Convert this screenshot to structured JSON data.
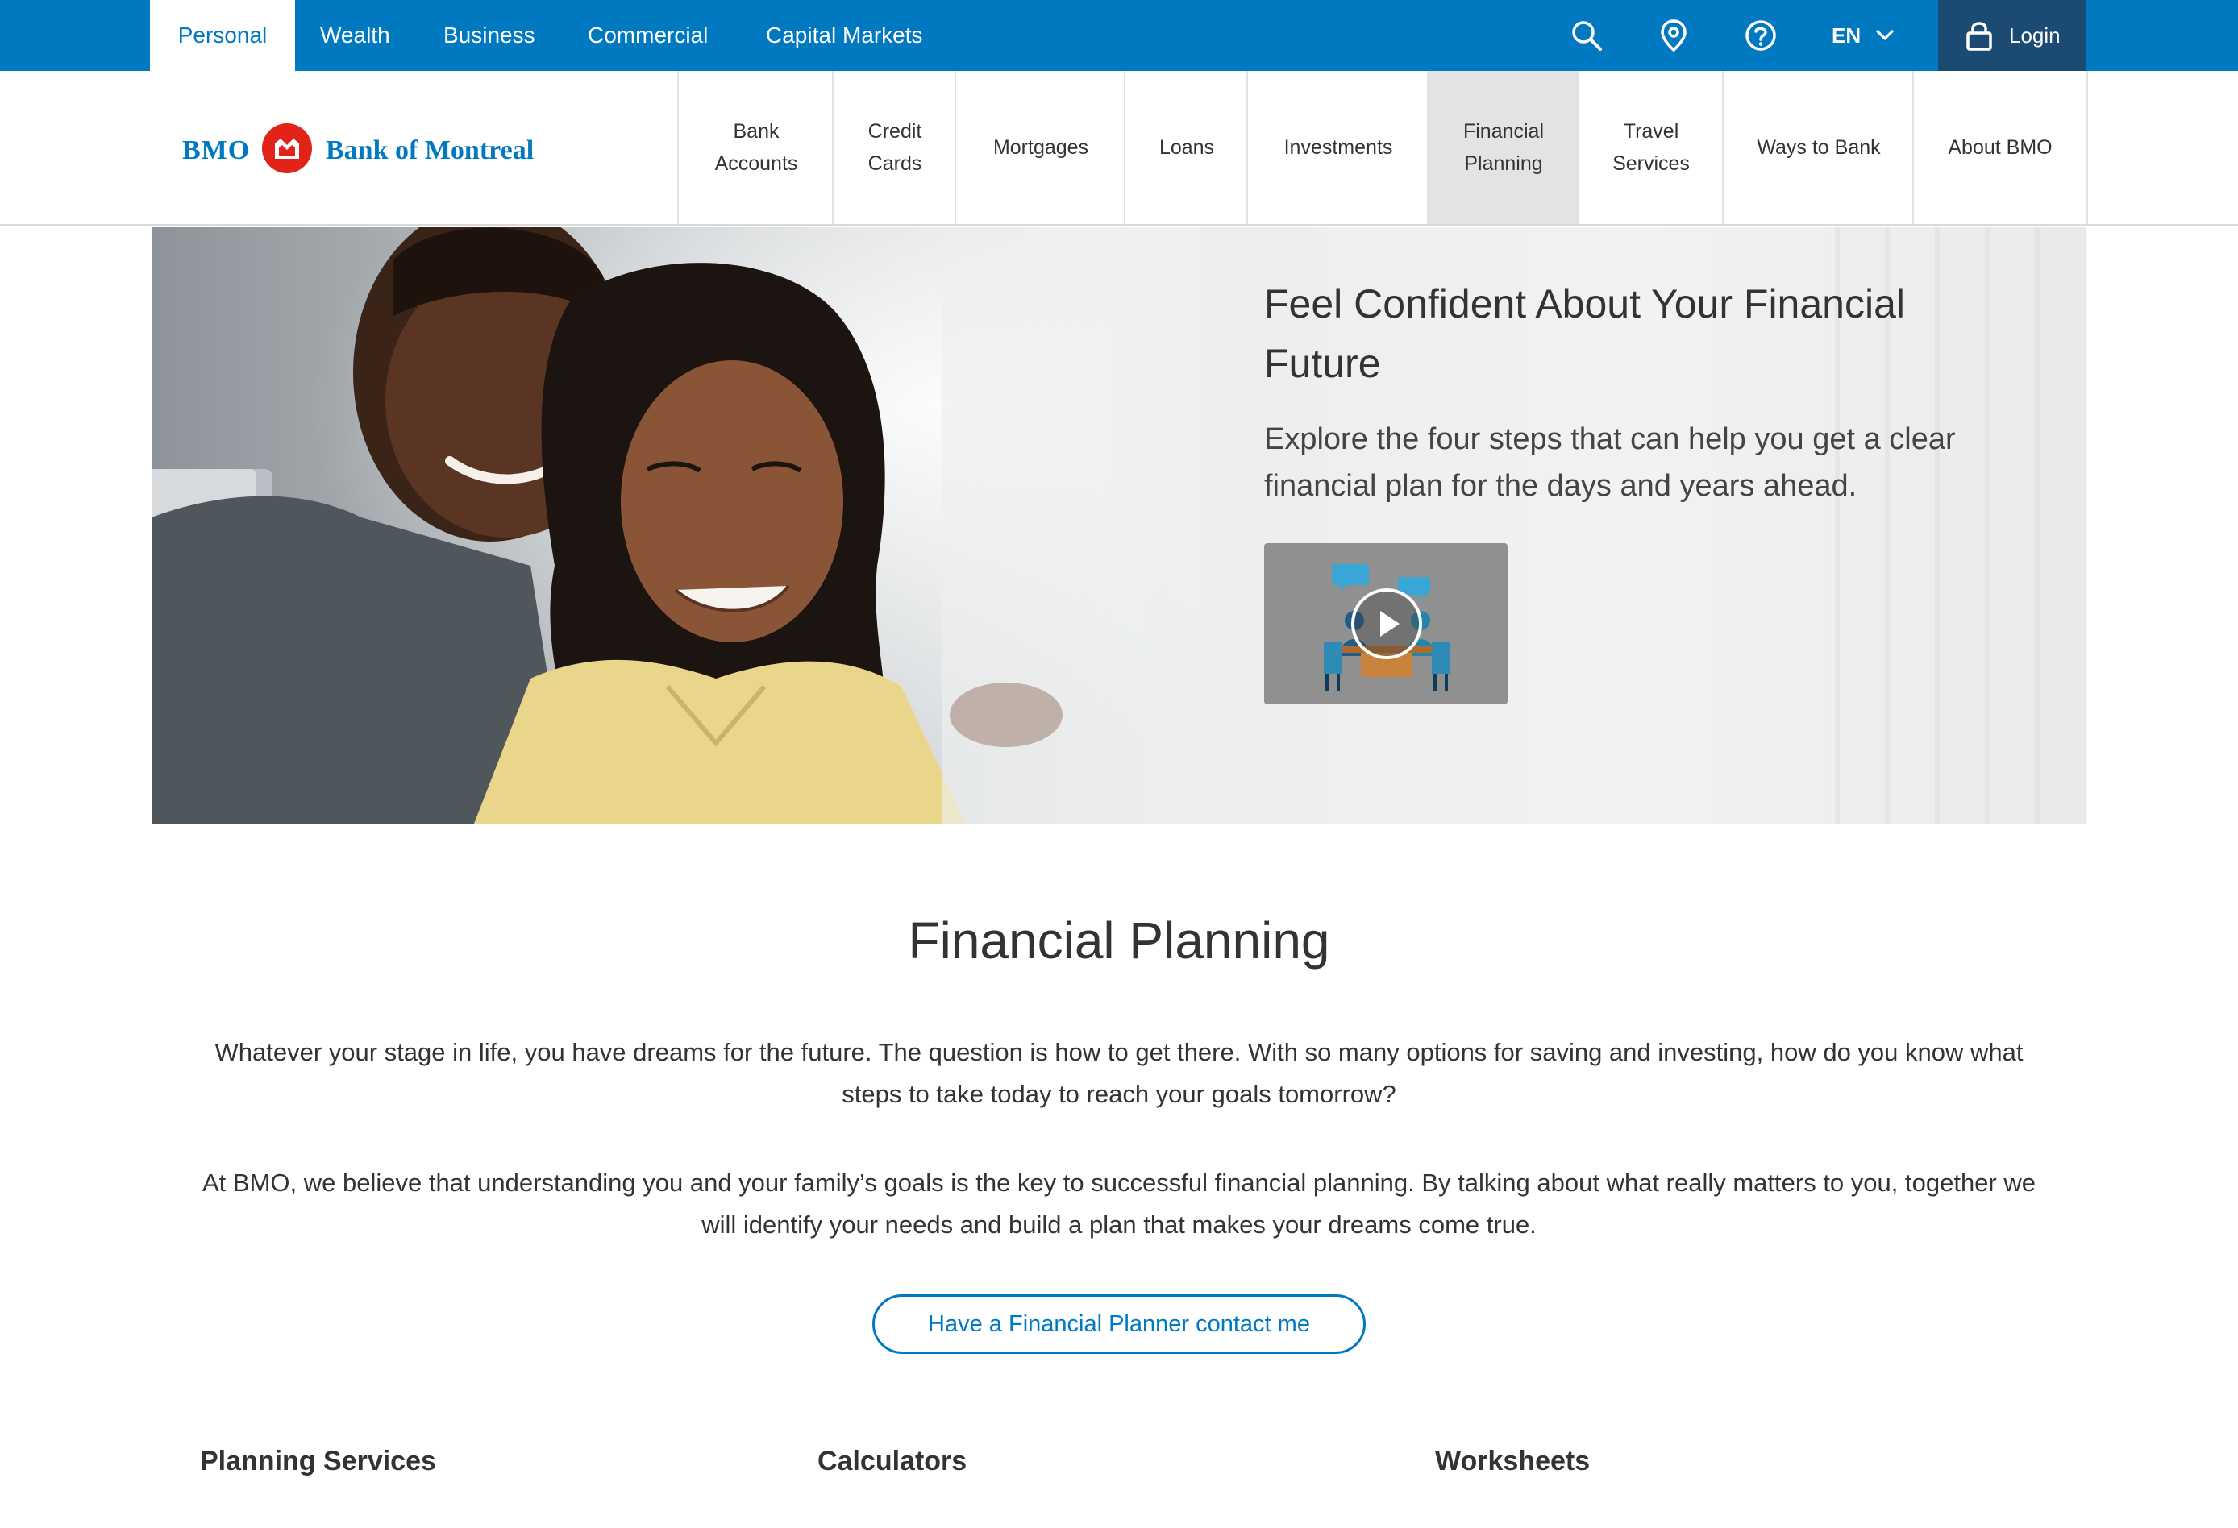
{
  "top_nav": {
    "segments": [
      {
        "label": "Personal",
        "active": true
      },
      {
        "label": "Wealth"
      },
      {
        "label": "Business"
      },
      {
        "label": "Commercial"
      },
      {
        "label": "Capital Markets"
      }
    ],
    "icons": [
      "search-icon",
      "location-icon",
      "help-icon"
    ],
    "language": "EN",
    "login_label": "Login"
  },
  "brand": {
    "short": "BMO",
    "name": "Bank of Montreal",
    "color": "#0079c1",
    "roundel_color": "#e2231a"
  },
  "main_nav": [
    {
      "label": "Bank Accounts"
    },
    {
      "label": "Credit Cards"
    },
    {
      "label": "Mortgages"
    },
    {
      "label": "Loans"
    },
    {
      "label": "Investments"
    },
    {
      "label": "Financial Planning",
      "active": true
    },
    {
      "label": "Travel Services"
    },
    {
      "label": "Ways to Bank"
    },
    {
      "label": "About BMO"
    }
  ],
  "hero": {
    "title": "Feel Confident About Your Financial Future",
    "subtitle": "Explore the four steps that can help you get a clear financial plan for the days and years ahead.",
    "video_icon": "play-icon"
  },
  "content": {
    "title": "Financial Planning",
    "para1": "Whatever your stage in life, you have dreams for the future. The question is how to get there. With so many options for saving and investing, how do you know what steps to take today to reach your goals tomorrow?",
    "para2": "At BMO, we believe that understanding you and your family’s goals is the key to successful financial planning. By talking about what really matters to you, together we will identify your needs and build a plan that makes your dreams come true.",
    "cta_label": "Have a Financial Planner contact me"
  },
  "sections": [
    "Planning Services",
    "Calculators",
    "Worksheets"
  ]
}
